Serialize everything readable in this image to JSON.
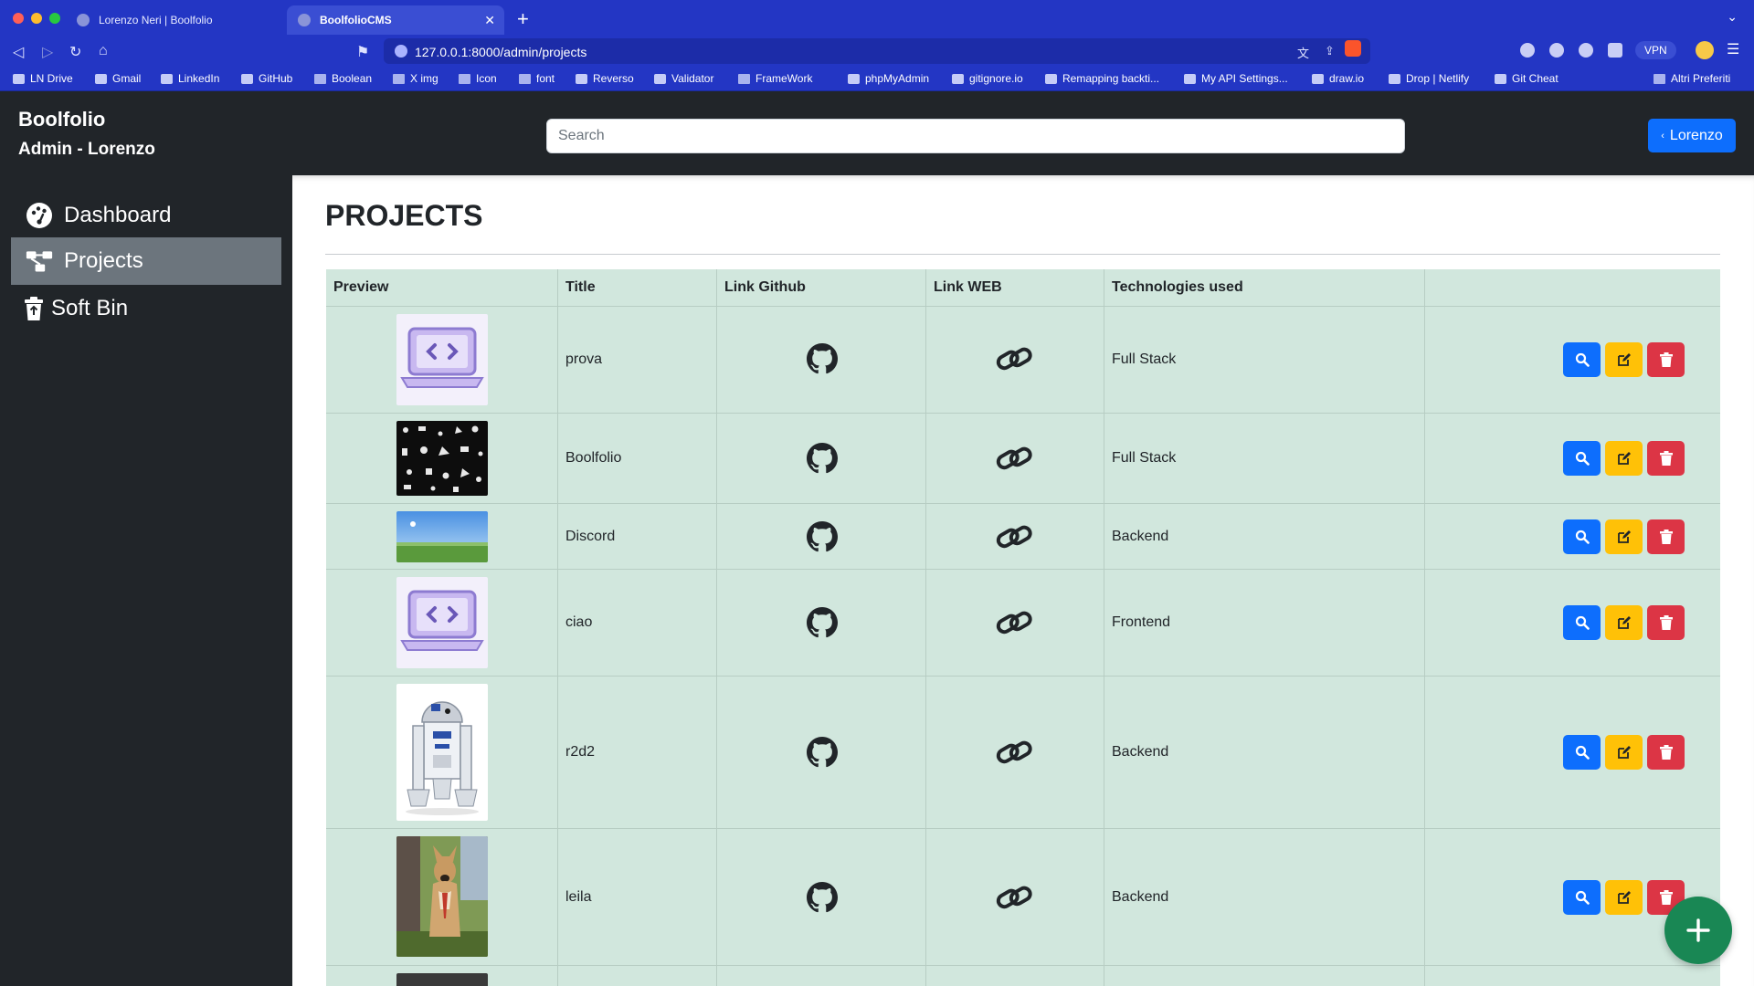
{
  "browser": {
    "tabs": [
      {
        "title": "Lorenzo Neri | Boolfolio",
        "active": false
      },
      {
        "title": "BoolfolioCMS",
        "active": true
      }
    ],
    "url": "127.0.0.1:8000/admin/projects",
    "vpn_label": "VPN",
    "bookmarks": [
      "LN Drive",
      "Gmail",
      "LinkedIn",
      "GitHub",
      "Boolean",
      "X img",
      "Icon",
      "font",
      "Reverso",
      "Validator",
      "FrameWork",
      "phpMyAdmin",
      "gitignore.io",
      "Remapping backti...",
      "My API Settings...",
      "draw.io",
      "Drop | Netlify",
      "Git Cheat",
      "Altri Preferiti"
    ]
  },
  "header": {
    "brand": "Boolfolio",
    "subtitle": "Admin - Lorenzo",
    "search_placeholder": "Search",
    "user_button": "Lorenzo"
  },
  "sidebar": {
    "items": [
      {
        "label": "Dashboard",
        "icon": "palette-icon",
        "active": false
      },
      {
        "label": "Projects",
        "icon": "diagram-icon",
        "active": true
      },
      {
        "label": "Soft Bin",
        "icon": "trash-icon",
        "active": false
      }
    ]
  },
  "main": {
    "title": "PROJECTS",
    "columns": [
      "Preview",
      "Title",
      "Link Github",
      "Link WEB",
      "Technologies used",
      ""
    ],
    "rows": [
      {
        "title": "prova",
        "technology": "Full Stack",
        "preview": "code-laptop-image"
      },
      {
        "title": "Boolfolio",
        "technology": "Full Stack",
        "preview": "starwars-pattern-image"
      },
      {
        "title": "Discord",
        "technology": "Backend",
        "preview": "landscape-image"
      },
      {
        "title": "ciao",
        "technology": "Frontend",
        "preview": "code-laptop-image"
      },
      {
        "title": "r2d2",
        "technology": "Backend",
        "preview": "r2d2-image"
      },
      {
        "title": "leila",
        "technology": "Backend",
        "preview": "dog-image"
      }
    ]
  },
  "colors": {
    "browser_chrome": "#2336c4",
    "header_bg": "#212529",
    "table_bg": "#d1e7dd",
    "primary": "#0d6efd",
    "warning": "#ffc107",
    "danger": "#dc3545",
    "success": "#198754"
  }
}
